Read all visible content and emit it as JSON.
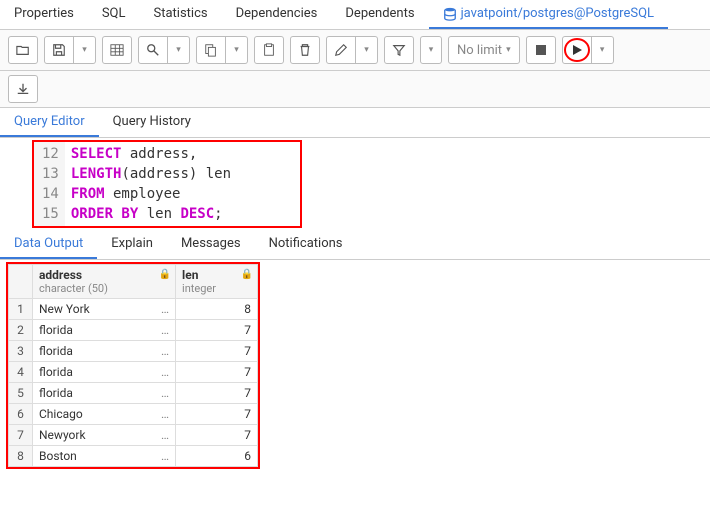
{
  "top_tabs": {
    "properties": "Properties",
    "sql": "SQL",
    "statistics": "Statistics",
    "dependencies": "Dependencies",
    "dependents": "Dependents",
    "active": "javatpoint/postgres@PostgreSQL"
  },
  "toolbar": {
    "nolimit": "No limit"
  },
  "sub_tabs": {
    "editor": "Query Editor",
    "history": "Query History"
  },
  "editor": {
    "lines": [
      "12",
      "13",
      "14",
      "15"
    ],
    "l12_kw": "SELECT",
    "l12_rest": " address,",
    "l13_fn": "LENGTH",
    "l13_paren1": "(",
    "l13_arg": "address",
    "l13_paren2": ")",
    "l13_rest": " len",
    "l14_kw": "FROM",
    "l14_rest": " employee",
    "l15_kw1": "ORDER BY",
    "l15_mid": " len ",
    "l15_kw2": "DESC",
    "l15_semi": ";"
  },
  "result_tabs": {
    "data": "Data Output",
    "explain": "Explain",
    "messages": "Messages",
    "notifications": "Notifications"
  },
  "grid": {
    "cols": [
      {
        "name": "address",
        "type": "character (50)"
      },
      {
        "name": "len",
        "type": "integer"
      }
    ],
    "rows": [
      {
        "n": "1",
        "address": "New York",
        "len": "8"
      },
      {
        "n": "2",
        "address": "florida",
        "len": "7"
      },
      {
        "n": "3",
        "address": "florida",
        "len": "7"
      },
      {
        "n": "4",
        "address": "florida",
        "len": "7"
      },
      {
        "n": "5",
        "address": "florida",
        "len": "7"
      },
      {
        "n": "6",
        "address": "Chicago",
        "len": "7"
      },
      {
        "n": "7",
        "address": "Newyork",
        "len": "7"
      },
      {
        "n": "8",
        "address": "Boston",
        "len": "6"
      }
    ]
  },
  "chart_data": {
    "type": "table",
    "title": "Data Output",
    "columns": [
      "address (character(50))",
      "len (integer)"
    ],
    "rows": [
      [
        "New York",
        8
      ],
      [
        "florida",
        7
      ],
      [
        "florida",
        7
      ],
      [
        "florida",
        7
      ],
      [
        "florida",
        7
      ],
      [
        "Chicago",
        7
      ],
      [
        "Newyork",
        7
      ],
      [
        "Boston",
        6
      ]
    ]
  }
}
